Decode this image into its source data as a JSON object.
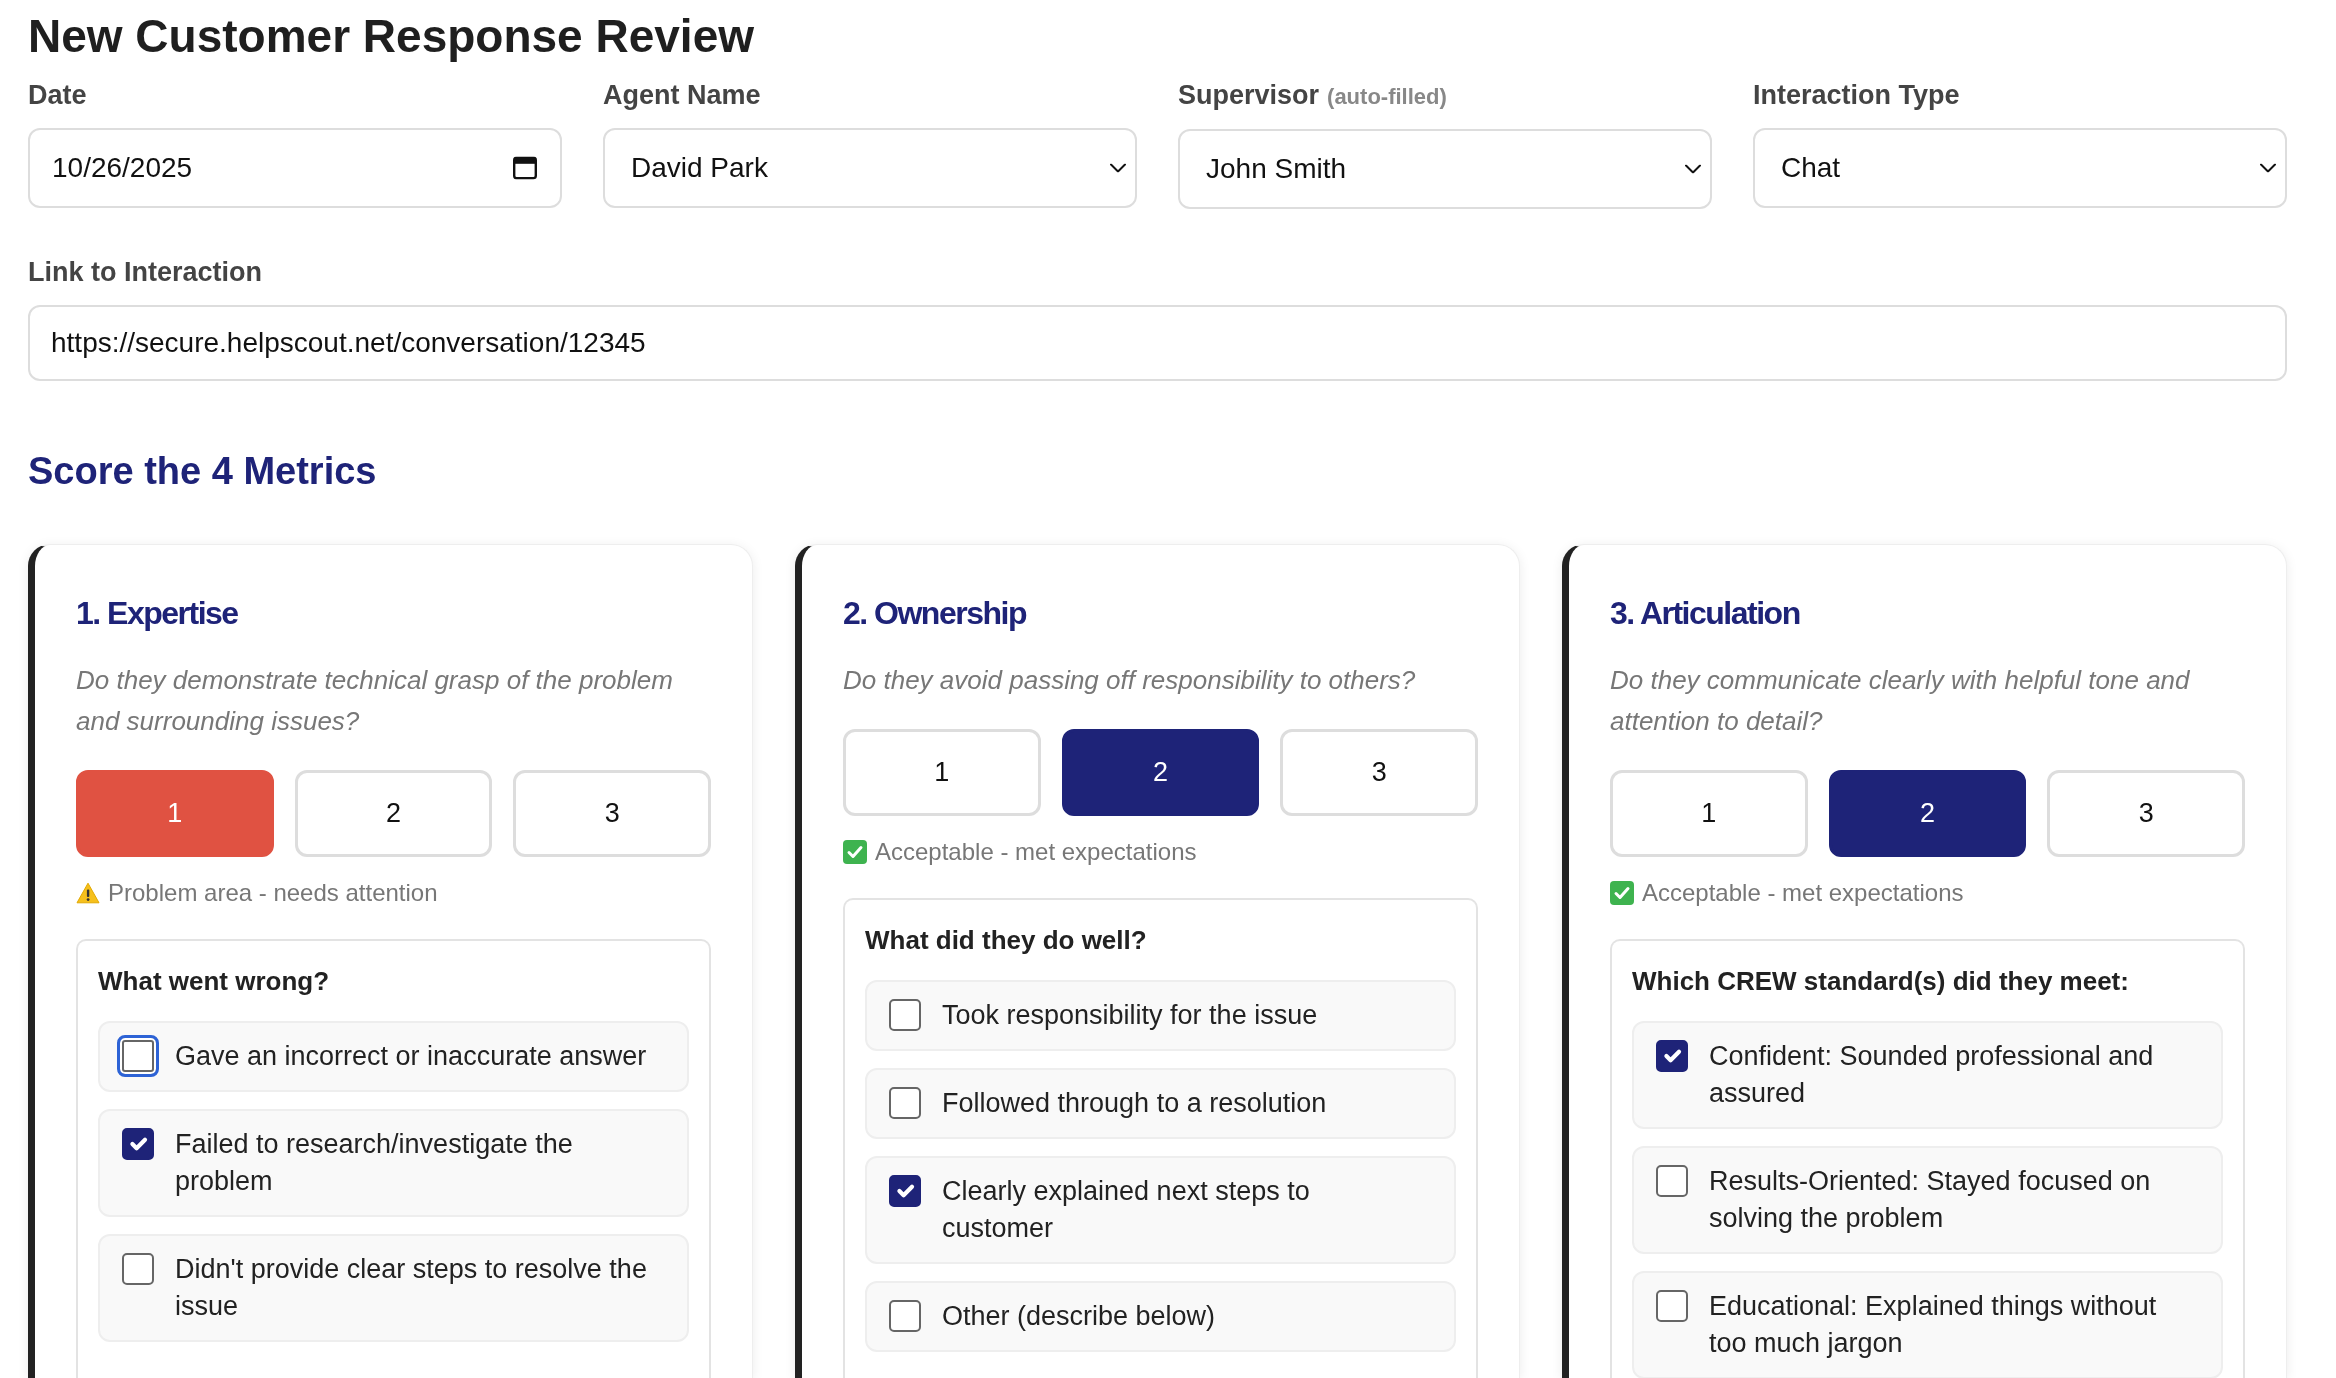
{
  "page_title": "New Customer Response Review",
  "fields": [
    {
      "kind": "date",
      "label": "Date",
      "value": "10/26/2025"
    },
    {
      "kind": "select",
      "label": "Agent Name",
      "value": "David Park"
    },
    {
      "kind": "select",
      "label": "Supervisor",
      "hint": "(auto-filled)",
      "value": "John Smith"
    },
    {
      "kind": "select",
      "label": "Interaction Type",
      "value": "Chat"
    }
  ],
  "link_field": {
    "label": "Link to Interaction",
    "value": "https://secure.helpscout.net/conversation/12345"
  },
  "section_title": "Score the 4 Metrics",
  "metrics": [
    {
      "title": "1. Expertise",
      "question": "Do they demonstrate technical grasp of the problem and surrounding issues?",
      "scores": [
        {
          "label": "1",
          "selected": true
        },
        {
          "label": "2",
          "selected": false
        },
        {
          "label": "3",
          "selected": false
        }
      ],
      "status": {
        "kind": "warning",
        "text": "Problem area - needs attention"
      },
      "checklist": {
        "title": "What went wrong?",
        "items": [
          {
            "label": "Gave an incorrect or inaccurate answer",
            "checked": false,
            "focused": true
          },
          {
            "label": "Failed to research/investigate the problem",
            "checked": true,
            "focused": false
          },
          {
            "label": "Didn't provide clear steps to resolve the issue",
            "checked": false,
            "focused": false
          }
        ]
      }
    },
    {
      "title": "2. Ownership",
      "question": "Do they avoid passing off responsibility to others?",
      "scores": [
        {
          "label": "1",
          "selected": false
        },
        {
          "label": "2",
          "selected": true
        },
        {
          "label": "3",
          "selected": false
        }
      ],
      "status": {
        "kind": "ok",
        "text": "Acceptable - met expectations"
      },
      "checklist": {
        "title": "What did they do well?",
        "items": [
          {
            "label": "Took responsibility for the issue",
            "checked": false,
            "focused": false
          },
          {
            "label": "Followed through to a resolution",
            "checked": false,
            "focused": false
          },
          {
            "label": "Clearly explained next steps to customer",
            "checked": true,
            "focused": false
          },
          {
            "label": "Other (describe below)",
            "checked": false,
            "focused": false
          }
        ]
      }
    },
    {
      "title": "3. Articulation",
      "question": "Do they communicate clearly with helpful tone and attention to detail?",
      "scores": [
        {
          "label": "1",
          "selected": false
        },
        {
          "label": "2",
          "selected": true
        },
        {
          "label": "3",
          "selected": false
        }
      ],
      "status": {
        "kind": "ok",
        "text": "Acceptable - met expectations"
      },
      "checklist": {
        "title": "Which CREW standard(s) did they meet:",
        "items": [
          {
            "label": "Confident: Sounded professional and assured",
            "checked": true,
            "focused": false
          },
          {
            "label": "Results-Oriented: Stayed focused on solving the problem",
            "checked": false,
            "focused": false
          },
          {
            "label": "Educational: Explained things without too much jargon",
            "checked": false,
            "focused": false
          }
        ]
      }
    }
  ]
}
